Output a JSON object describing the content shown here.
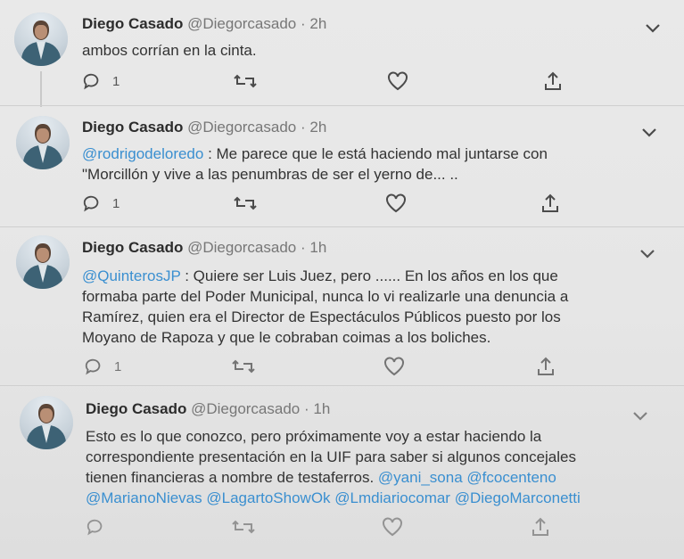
{
  "tweets": [
    {
      "name": "Diego Casado",
      "handle": "@Diegorcasado",
      "sep": "·",
      "time": "2h",
      "text_parts": [
        {
          "t": "ambos corrían en la cinta.",
          "mention": false
        }
      ],
      "reply_count": "1"
    },
    {
      "name": "Diego Casado",
      "handle": "@Diegorcasado",
      "sep": "·",
      "time": "2h",
      "lines": [
        [
          {
            "t": "@rodrigodeloredo",
            "mention": true
          },
          {
            "t": " : Me parece que le está haciendo mal juntarse con",
            "mention": false
          }
        ],
        [
          {
            "t": "\"Morcillón  y vive a las penumbras de ser el yerno de... ..",
            "mention": false
          }
        ]
      ],
      "reply_count": "1"
    },
    {
      "name": "Diego Casado",
      "handle": "@Diegorcasado",
      "sep": "·",
      "time": "1h",
      "lines": [
        [
          {
            "t": "@QuinterosJP",
            "mention": true
          },
          {
            "t": " : Quiere ser Luis Juez, pero ...... En los años en los que",
            "mention": false
          }
        ],
        [
          {
            "t": "formaba parte del Poder Municipal, nunca lo vi realizarle una denuncia a",
            "mention": false
          }
        ],
        [
          {
            "t": "Ramírez, quien era el Director de Espectáculos Públicos puesto por los",
            "mention": false
          }
        ],
        [
          {
            "t": "Moyano de Rapoza y que le cobraban coimas a los boliches.",
            "mention": false
          }
        ]
      ],
      "reply_count": "1"
    },
    {
      "name": "Diego Casado",
      "handle": "@Diegorcasado",
      "sep": "·",
      "time": "1h",
      "lines": [
        [
          {
            "t": "Esto es lo que conozco, pero próximamente voy a estar haciendo la",
            "mention": false
          }
        ],
        [
          {
            "t": "correspondiente presentación en la UIF para saber si algunos concejales",
            "mention": false
          }
        ],
        [
          {
            "t": "tienen financieras a nombre de testaferros. ",
            "mention": false
          },
          {
            "t": "@yani_sona",
            "mention": true
          },
          {
            "t": " ",
            "mention": false
          },
          {
            "t": "@fcocenteno",
            "mention": true
          }
        ],
        [
          {
            "t": "@MarianoNievas",
            "mention": true
          },
          {
            "t": " ",
            "mention": false
          },
          {
            "t": "@LagartoShowOk",
            "mention": true
          },
          {
            "t": " ",
            "mention": false
          },
          {
            "t": "@Lmdiariocomar",
            "mention": true
          },
          {
            "t": " ",
            "mention": false
          },
          {
            "t": "@DiegoMarconetti",
            "mention": true
          }
        ]
      ],
      "reply_count": ""
    }
  ],
  "icons": {
    "reply": "reply-icon",
    "retweet": "retweet-icon",
    "like": "heart-icon",
    "share": "share-icon",
    "menu": "chevron-down-icon"
  },
  "colors": {
    "mention": "#3a8fd0",
    "name": "#2c2c2c",
    "meta": "#777777",
    "background": "#e8e8e8"
  }
}
